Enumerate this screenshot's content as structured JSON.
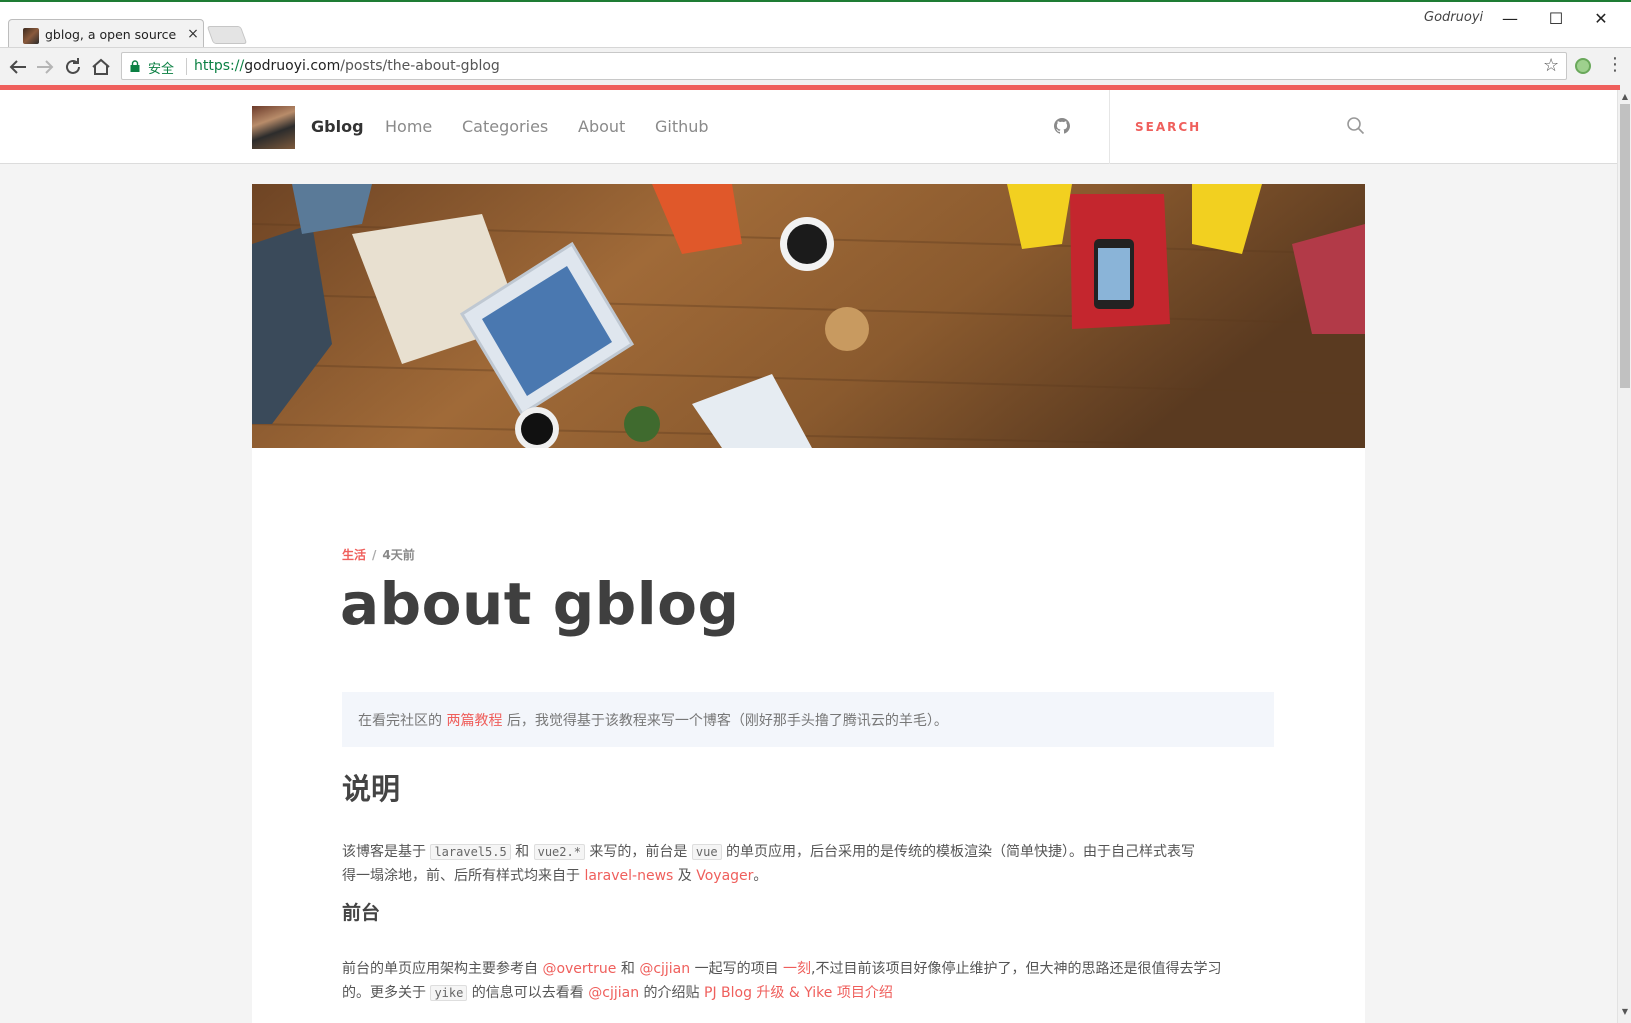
{
  "browser": {
    "tab_title": "gblog, a open source b",
    "tab_close": "×",
    "profile_name": "Godruoyi",
    "window_controls": {
      "minimize": "—",
      "maximize": "☐",
      "close": "✕"
    },
    "secure_label": "安全",
    "url_scheme": "https://",
    "url_host": "godruoyi.com",
    "url_path": "/posts/the-about-gblog",
    "accent_color": "#ef5f5c"
  },
  "header": {
    "brand": "Gblog",
    "nav": [
      "Home",
      "Categories",
      "About",
      "Github"
    ],
    "search_label": "SEARCH"
  },
  "post": {
    "category": "生活",
    "separator": "/",
    "time": "4天前",
    "title": "about gblog",
    "notice": {
      "before": "在看完社区的 ",
      "link": "两篇教程",
      "after": " 后，我觉得基于该教程来写一个博客（刚好那手头撸了腾讯云的羊毛）。"
    },
    "section_title": "说明",
    "para1": {
      "t1": "该博客是基于 ",
      "c1": "laravel5.5",
      "t2": " 和 ",
      "c2": "vue2.*",
      "t3": " 来写的，前台是 ",
      "c3": "vue",
      "t4": " 的单页应用，后台采用的是传统的模板渲染（简单快捷）。由于自己样式表写",
      "t5": "得一塌涂地，前、后所有样式均来自于 ",
      "l1": "laravel-news",
      "t6": " 及 ",
      "l2": "Voyager",
      "t7": "。"
    },
    "subsection_title": "前台",
    "para2": {
      "t1": "前台的单页应用架构主要参考自 ",
      "l1": "@overtrue",
      "t2": " 和 ",
      "l2": "@cjjian",
      "t3": " 一起写的项目 ",
      "l3": "一刻",
      "t4": ",不过目前该项目好像停止维护了，但大神的思路还是很值得去学习",
      "t5": "的。更多关于 ",
      "c1": "yike",
      "t6": " 的信息可以去看看 ",
      "l4": "@cjjian",
      "t7": " 的介绍贴 ",
      "l5": "PJ Blog 升级 & Yike 项目介绍"
    }
  }
}
